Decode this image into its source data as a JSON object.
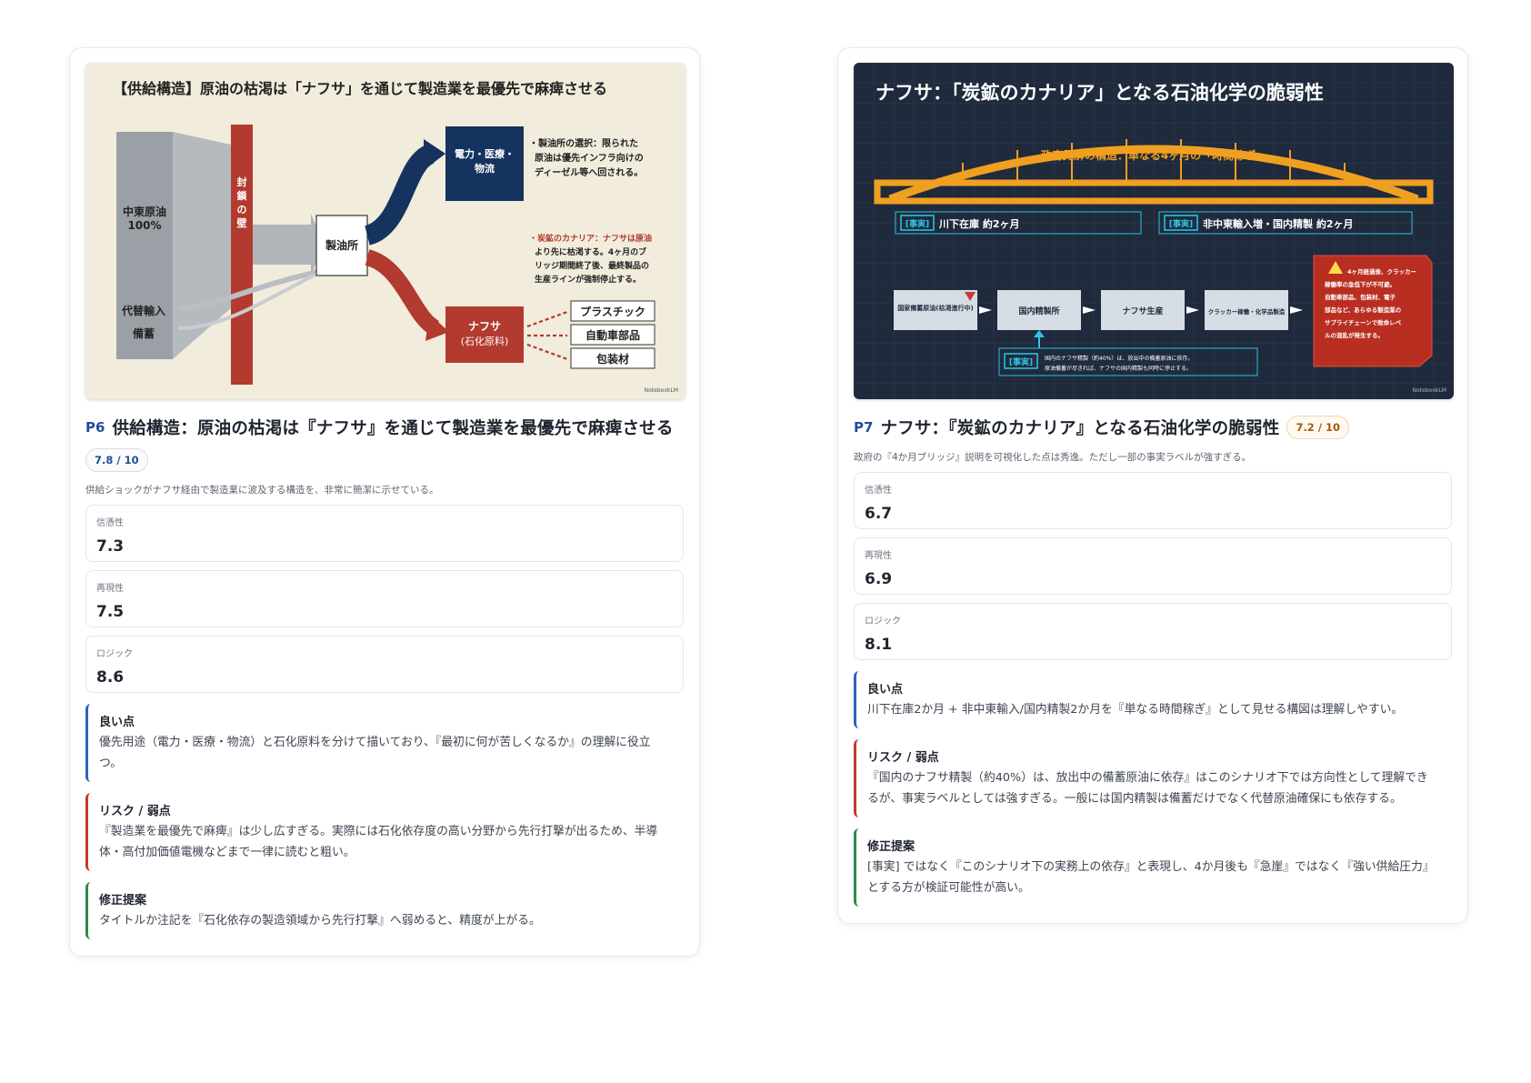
{
  "cards": [
    {
      "page": "P6",
      "title": "供給構造：原油の枯渇は『ナフサ』を通じて製造業を最優先で麻痺させる",
      "score": "7.8 / 10",
      "summary": "供給ショックがナフサ経由で製造業に波及する構造を、非常に簡潔に示せている。",
      "metrics": [
        {
          "label": "信憑性",
          "value": "7.3"
        },
        {
          "label": "再現性",
          "value": "7.5"
        },
        {
          "label": "ロジック",
          "value": "8.6"
        }
      ],
      "good": {
        "title": "良い点",
        "body": "優先用途（電力・医療・物流）と石化原料を分けて描いており、『最初に何が苦しくなるか』の理解に役立つ。"
      },
      "risk": {
        "title": "リスク / 弱点",
        "body": "『製造業を最優先で麻痺』は少し広すぎる。実際には石化依存度の高い分野から先行打撃が出るため、半導体・高付加価値電機などまで一律に読むと粗い。"
      },
      "fix": {
        "title": "修正提案",
        "body": "タイトルか注記を『石化依存の製造領域から先行打撃』へ弱めると、精度が上がる。"
      },
      "slide": {
        "heading": "【供給構造】原油の枯渇は「ナフサ」を通じて製造業を最優先で麻痺させる",
        "source_l1": "中東原油",
        "source_l2": "100%",
        "wall": [
          "封",
          "鎖",
          "の",
          "壁"
        ],
        "alt_import": "代替輸入",
        "reserve": "備蓄",
        "refinery": "製油所",
        "priority_l1": "電力・医療・",
        "priority_l2": "物流",
        "naphtha_l1": "ナフサ",
        "naphtha_l2": "(石化原料)",
        "products": [
          "プラスチック",
          "自動車部品",
          "包装材"
        ],
        "note1": [
          "・製油所の選択：限られた",
          "原油は優先インフラ向けの",
          "ディーゼル等へ回される。"
        ],
        "note2": [
          "・炭鉱のカナリア：ナフサは原油",
          "より先に枯渇する。4ヶ月のブ",
          "リッジ期間終了後、最終製品の",
          "生産ラインが強制停止する。"
        ],
        "credit": "NotebookLM"
      }
    },
    {
      "page": "P7",
      "title": "ナフサ：『炭鉱のカナリア』となる石油化学の脆弱性",
      "score": "7.2 / 10",
      "summary": "政府の『4か月ブリッジ』説明を可視化した点は秀逸。ただし一部の事実ラベルが強すぎる。",
      "metrics": [
        {
          "label": "信憑性",
          "value": "6.7"
        },
        {
          "label": "再現性",
          "value": "6.9"
        },
        {
          "label": "ロジック",
          "value": "8.1"
        }
      ],
      "good": {
        "title": "良い点",
        "body": "川下在庫2か月 + 非中東輸入/国内精製2か月を『単なる時間稼ぎ』として見せる構図は理解しやすい。"
      },
      "risk": {
        "title": "リスク / 弱点",
        "body": "『国内のナフサ精製（約40%）は、放出中の備蓄原油に依存』はこのシナリオ下では方向性として理解できるが、事実ラベルとしては強すぎる。一般には国内精製は備蓄だけでなく代替原油確保にも依存する。"
      },
      "fix": {
        "title": "修正提案",
        "body": "[事実] ではなく『このシナリオ下の実務上の依存』と表現し、4か月後も『急崖』ではなく『強い供給圧力』とする方が検証可能性が高い。"
      },
      "slide": {
        "heading": "ナフサ：「炭鉱のカナリア」となる石油化学の脆弱性",
        "bridge_label": "政府見解の構造：単なる4ヶ月の「時間稼ぎ」",
        "fact_tag": "[事実]",
        "fact1": "川下在庫 約2ヶ月",
        "fact2": "非中東輸入増・国内精製 約2ヶ月",
        "flow": [
          "国家備蓄原油(枯渇進行中)",
          "国内精製所",
          "ナフサ生産",
          "クラッカー稼働・化学品製造"
        ],
        "fact3_l1": "国内のナフサ精製（約40%）は、放出中の備蓄原油に依存。",
        "fact3_l2": "原油備蓄が尽きれば、ナフサの国内精製も同時に停止する。",
        "warning": [
          "4ヶ月経過後、クラッカー",
          "稼働率の急低下が不可避。",
          "自動車部品、包装材、電子",
          "部品など、あらゆる製造業の",
          "サプライチェーンで致命レベ",
          "ルの混乱が発生する。"
        ],
        "credit": "NotebookLM"
      }
    }
  ]
}
